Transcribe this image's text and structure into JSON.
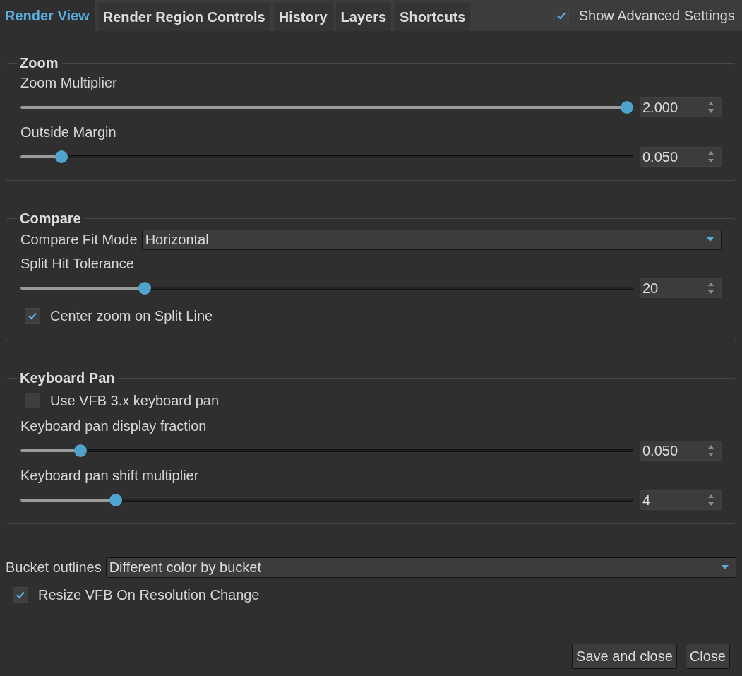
{
  "tabs": [
    {
      "label": "Render View",
      "selected": true
    },
    {
      "label": "Render Region Controls",
      "selected": false
    },
    {
      "label": "History",
      "selected": false
    },
    {
      "label": "Layers",
      "selected": false
    },
    {
      "label": "Shortcuts",
      "selected": false
    }
  ],
  "show_advanced_settings": {
    "label": "Show Advanced Settings",
    "checked": true
  },
  "groups": [
    {
      "title": "Zoom",
      "items": [
        {
          "kind": "slider",
          "label": "Zoom Multiplier",
          "level": 1.0,
          "value": "2.000"
        },
        {
          "kind": "slider",
          "label": "Outside Margin",
          "level": 0.058,
          "value": "0.050"
        }
      ]
    },
    {
      "title": "Compare",
      "items": [
        {
          "kind": "combo",
          "label": "Compare Fit Mode",
          "value": "Horizontal"
        },
        {
          "kind": "slider",
          "label": "Split Hit Tolerance",
          "level": 0.197,
          "value": "20"
        },
        {
          "kind": "checkbox",
          "label": "Center zoom on Split Line",
          "checked": true
        }
      ]
    },
    {
      "title": "Keyboard Pan",
      "items": [
        {
          "kind": "checkbox",
          "label": "Use VFB 3.x keyboard pan",
          "checked": false
        },
        {
          "kind": "slider",
          "label": "Keyboard pan display fraction",
          "level": 0.089,
          "value": "0.050"
        },
        {
          "kind": "slider",
          "label": "Keyboard pan shift multiplier",
          "level": 0.148,
          "value": "4"
        }
      ]
    }
  ],
  "settings": [
    {
      "kind": "combo",
      "label": "Bucket outlines",
      "value": "Different color by bucket"
    },
    {
      "kind": "checkbox",
      "label": "Resize VFB On Resolution Change",
      "checked": true
    }
  ],
  "buttons": [
    "Save and close",
    "Close"
  ]
}
